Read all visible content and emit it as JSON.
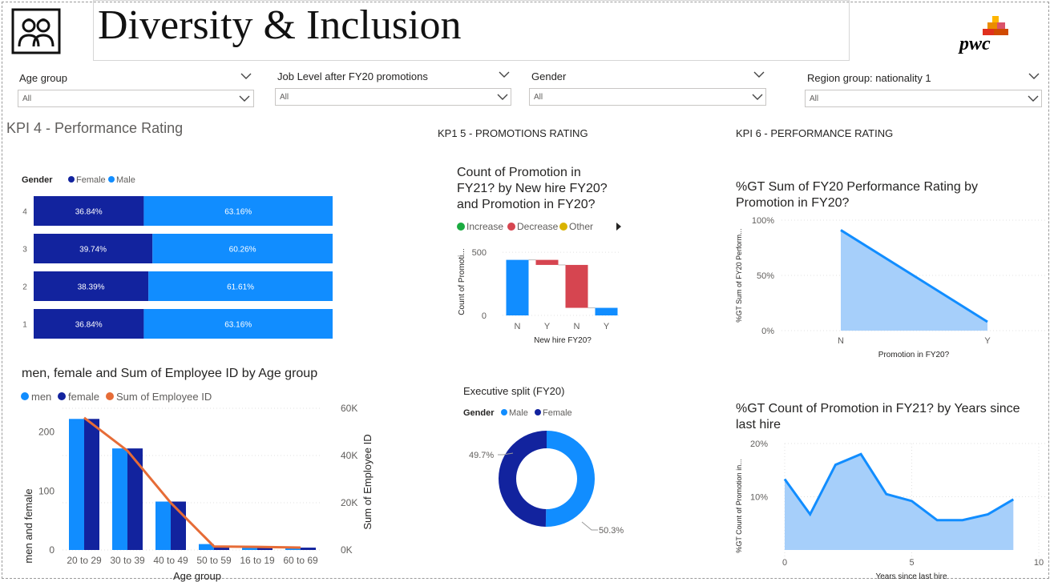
{
  "header": {
    "title": "Diversity & Inclusion",
    "logo_text": "pwc",
    "people_icon": "people-icon"
  },
  "filters": [
    {
      "label": "Age group",
      "value": "All"
    },
    {
      "label": "Job Level after FY20 promotions",
      "value": "All"
    },
    {
      "label": "Gender",
      "value": "All"
    },
    {
      "label": "Region group: nationality 1",
      "value": "All"
    }
  ],
  "sections": {
    "kpi4": "KPI 4 - Performance Rating",
    "kpi5": "KP1 5 - PROMOTIONS RATING",
    "kpi6": "KPI 6 - PERFORMANCE RATING"
  },
  "colors": {
    "male": "#118DFF",
    "female": "#12239E",
    "line": "#E66C37",
    "increase": "#1AAB40",
    "decrease": "#D64550",
    "other": "#D9B300",
    "area_fill": "#A6CFFA"
  },
  "chart_data": [
    {
      "type": "bar",
      "subtype": "100% stacked horizontal",
      "legend_title": "Gender",
      "categories": [
        "4",
        "3",
        "2",
        "1"
      ],
      "series": [
        {
          "name": "Female",
          "values": [
            36.84,
            39.74,
            38.39,
            36.84
          ],
          "labels": [
            "36.84%",
            "39.74%",
            "38.39%",
            "36.84%"
          ]
        },
        {
          "name": "Male",
          "values": [
            63.16,
            60.26,
            61.61,
            63.16
          ],
          "labels": [
            "63.16%",
            "60.26%",
            "61.61%",
            "63.16%"
          ]
        }
      ]
    },
    {
      "type": "bar",
      "subtype": "clustered column + line",
      "title": "men, female and Sum of Employee ID by Age group",
      "xlabel": "Age group",
      "ylabel": "men and female",
      "y2label": "Sum of Employee ID",
      "categories": [
        "20 to 29",
        "30 to 39",
        "40 to 49",
        "50 to 59",
        "16 to 19",
        "60 to 69"
      ],
      "series": [
        {
          "name": "men",
          "values": [
            222,
            172,
            82,
            10,
            6,
            4
          ]
        },
        {
          "name": "female",
          "values": [
            222,
            172,
            82,
            6,
            5,
            4
          ]
        },
        {
          "name": "Sum of Employee ID",
          "axis": "y2",
          "values": [
            56000,
            42000,
            20000,
            1500,
            1300,
            1000
          ]
        }
      ],
      "ylim": [
        0,
        240
      ],
      "y_ticks": [
        "0",
        "100",
        "200"
      ],
      "y_tick_values": [
        0,
        100,
        200
      ],
      "y2lim": [
        0,
        60000
      ],
      "y2_ticks": [
        "0K",
        "20K",
        "40K",
        "60K"
      ],
      "y2_tick_values": [
        0,
        20000,
        40000,
        60000
      ]
    },
    {
      "type": "bar",
      "subtype": "waterfall",
      "title": "Count of Promotion in FY21? by New hire FY20? and Promotion in FY20?",
      "title_lines": [
        "Count of Promotion in",
        "FY21? by New hire FY20?",
        "and Promotion in FY20?"
      ],
      "xlabel": "New hire FY20?",
      "ylabel": "Count of Promoti...",
      "legend": [
        "Increase",
        "Decrease",
        "Other"
      ],
      "categories": [
        "N",
        "Y",
        "N",
        "Y"
      ],
      "steps": [
        {
          "kind": "increase",
          "from": 0,
          "to": 440
        },
        {
          "kind": "decrease",
          "from": 440,
          "to": 400
        },
        {
          "kind": "decrease",
          "from": 400,
          "to": 60
        },
        {
          "kind": "increase",
          "from": 0,
          "to": 60
        }
      ],
      "ylim": [
        0,
        520
      ],
      "y_ticks": [
        "0",
        "500"
      ],
      "y_tick_values": [
        0,
        500
      ]
    },
    {
      "type": "pie",
      "subtype": "donut",
      "title": "Executive split (FY20)",
      "legend_title": "Gender",
      "series": [
        {
          "name": "Male",
          "value": 50.3,
          "label": "50.3%"
        },
        {
          "name": "Female",
          "value": 49.7,
          "label": "49.7%"
        }
      ]
    },
    {
      "type": "area",
      "title": "%GT Sum of FY20 Performance Rating by Promotion in FY20?",
      "title_lines": [
        "%GT Sum of FY20 Performance Rating by",
        "Promotion in FY20?"
      ],
      "xlabel": "Promotion in FY20?",
      "ylabel": "%GT Sum of FY20 Perform...",
      "categories": [
        "N",
        "Y"
      ],
      "values": [
        91,
        8
      ],
      "ylim": [
        0,
        100
      ],
      "y_ticks": [
        "0%",
        "50%",
        "100%"
      ],
      "y_tick_values": [
        0,
        50,
        100
      ]
    },
    {
      "type": "area",
      "title": "%GT Count of Promotion in FY21? by Years since last hire",
      "title_lines": [
        "%GT Count of Promotion in FY21? by Years since",
        "last hire"
      ],
      "xlabel": "Years since last hire",
      "ylabel": "%GT Count of Promotion in...",
      "x": [
        0,
        1,
        2,
        3,
        4,
        5,
        6,
        7,
        8,
        9
      ],
      "values": [
        13.3,
        6.7,
        16.0,
        18.0,
        10.5,
        9.2,
        5.6,
        5.6,
        6.7,
        9.5
      ],
      "xlim": [
        0,
        10
      ],
      "x_ticks": [
        "0",
        "5",
        "10"
      ],
      "x_tick_values": [
        0,
        5,
        10
      ],
      "ylim": [
        0,
        20
      ],
      "y_ticks": [
        "10%",
        "20%"
      ],
      "y_tick_values": [
        10,
        20
      ]
    }
  ]
}
